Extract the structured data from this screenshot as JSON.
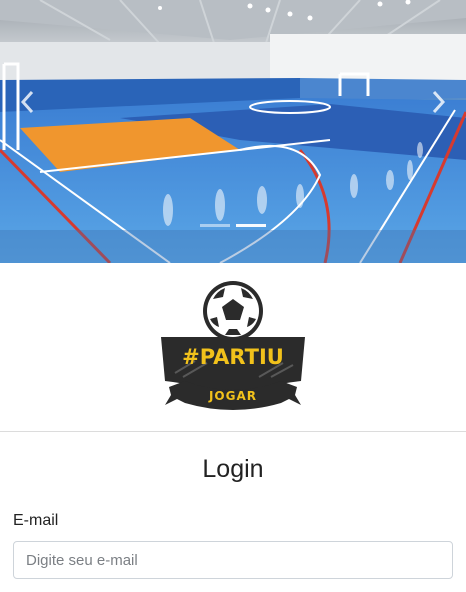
{
  "carousel": {
    "slide_image": "futsal-court-photo",
    "prev_icon": "chevron-left-icon",
    "next_icon": "chevron-right-icon",
    "indicator_count": 2,
    "active_indicator": 1
  },
  "logo": {
    "line1": "#PARTIU",
    "line2": "JOGAR",
    "text_color": "#f2c21b",
    "badge_color": "#2b2b2b"
  },
  "login": {
    "title": "Login",
    "email_label": "E-mail",
    "email_placeholder": "Digite seu e-mail",
    "email_value": ""
  }
}
